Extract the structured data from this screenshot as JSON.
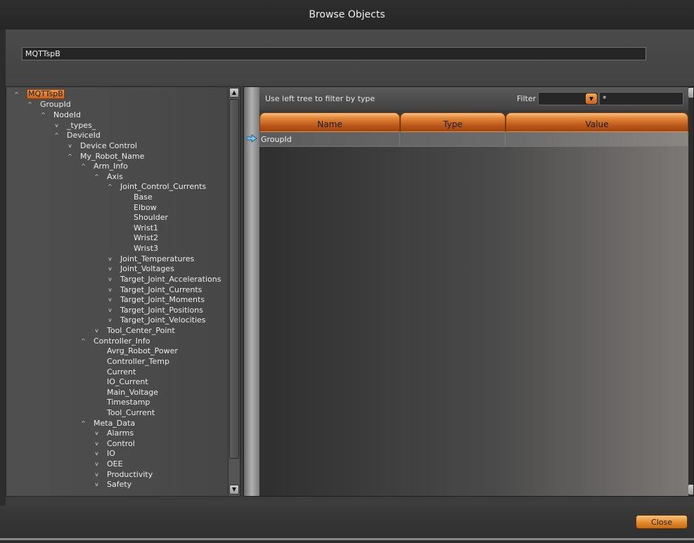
{
  "window": {
    "title": "Browse Objects"
  },
  "path": {
    "value": "MQTTspB"
  },
  "tree": {
    "items": [
      {
        "label": "MQTTspB",
        "depth": 0,
        "chevron": "up",
        "selected": true
      },
      {
        "label": "GroupId",
        "depth": 1,
        "chevron": "up"
      },
      {
        "label": "NodeId",
        "depth": 2,
        "chevron": "up"
      },
      {
        "label": "_types_",
        "depth": 3,
        "chevron": "down"
      },
      {
        "label": "DeviceId",
        "depth": 3,
        "chevron": "up"
      },
      {
        "label": "Device Control",
        "depth": 4,
        "chevron": "down"
      },
      {
        "label": "My_Robot_Name",
        "depth": 4,
        "chevron": "up"
      },
      {
        "label": "Arm_Info",
        "depth": 5,
        "chevron": "up"
      },
      {
        "label": "Axis",
        "depth": 6,
        "chevron": "up"
      },
      {
        "label": "Joint_Control_Currents",
        "depth": 7,
        "chevron": "up"
      },
      {
        "label": "Base",
        "depth": 8,
        "chevron": "none"
      },
      {
        "label": "Elbow",
        "depth": 8,
        "chevron": "none"
      },
      {
        "label": "Shoulder",
        "depth": 8,
        "chevron": "none"
      },
      {
        "label": "Wrist1",
        "depth": 8,
        "chevron": "none"
      },
      {
        "label": "Wrist2",
        "depth": 8,
        "chevron": "none"
      },
      {
        "label": "Wrist3",
        "depth": 8,
        "chevron": "none"
      },
      {
        "label": "Joint_Temperatures",
        "depth": 7,
        "chevron": "down"
      },
      {
        "label": "Joint_Voltages",
        "depth": 7,
        "chevron": "down"
      },
      {
        "label": "Target_Joint_Accelerations",
        "depth": 7,
        "chevron": "down"
      },
      {
        "label": "Target_Joint_Currents",
        "depth": 7,
        "chevron": "down"
      },
      {
        "label": "Target_Joint_Moments",
        "depth": 7,
        "chevron": "down"
      },
      {
        "label": "Target_Joint_Positions",
        "depth": 7,
        "chevron": "down"
      },
      {
        "label": "Target_Joint_Velocities",
        "depth": 7,
        "chevron": "down"
      },
      {
        "label": "Tool_Center_Point",
        "depth": 6,
        "chevron": "down"
      },
      {
        "label": "Controller_Info",
        "depth": 5,
        "chevron": "up"
      },
      {
        "label": "Avrg_Robot_Power",
        "depth": 6,
        "chevron": "none"
      },
      {
        "label": "Controller_Temp",
        "depth": 6,
        "chevron": "none"
      },
      {
        "label": "Current",
        "depth": 6,
        "chevron": "none"
      },
      {
        "label": "IO_Current",
        "depth": 6,
        "chevron": "none"
      },
      {
        "label": "Main_Voltage",
        "depth": 6,
        "chevron": "none"
      },
      {
        "label": "Timestamp",
        "depth": 6,
        "chevron": "none"
      },
      {
        "label": "Tool_Current",
        "depth": 6,
        "chevron": "none"
      },
      {
        "label": "Meta_Data",
        "depth": 5,
        "chevron": "up"
      },
      {
        "label": "Alarms",
        "depth": 6,
        "chevron": "down"
      },
      {
        "label": "Control",
        "depth": 6,
        "chevron": "down"
      },
      {
        "label": "IO",
        "depth": 6,
        "chevron": "down"
      },
      {
        "label": "OEE",
        "depth": 6,
        "chevron": "down"
      },
      {
        "label": "Productivity",
        "depth": 6,
        "chevron": "down"
      },
      {
        "label": "Safety",
        "depth": 6,
        "chevron": "down"
      }
    ]
  },
  "filter": {
    "hint": "Use left tree to filter by type",
    "label": "Filter",
    "type_value": "",
    "text_value": "*"
  },
  "grid": {
    "columns": [
      "Name",
      "Type",
      "Value"
    ],
    "rows": [
      {
        "name": "GroupId",
        "type": "",
        "value": ""
      }
    ]
  },
  "footer": {
    "close_label": "Close"
  },
  "colors": {
    "accent": "#e48a3a",
    "accent_dark": "#b9561a",
    "background": "#3c3c3c"
  }
}
